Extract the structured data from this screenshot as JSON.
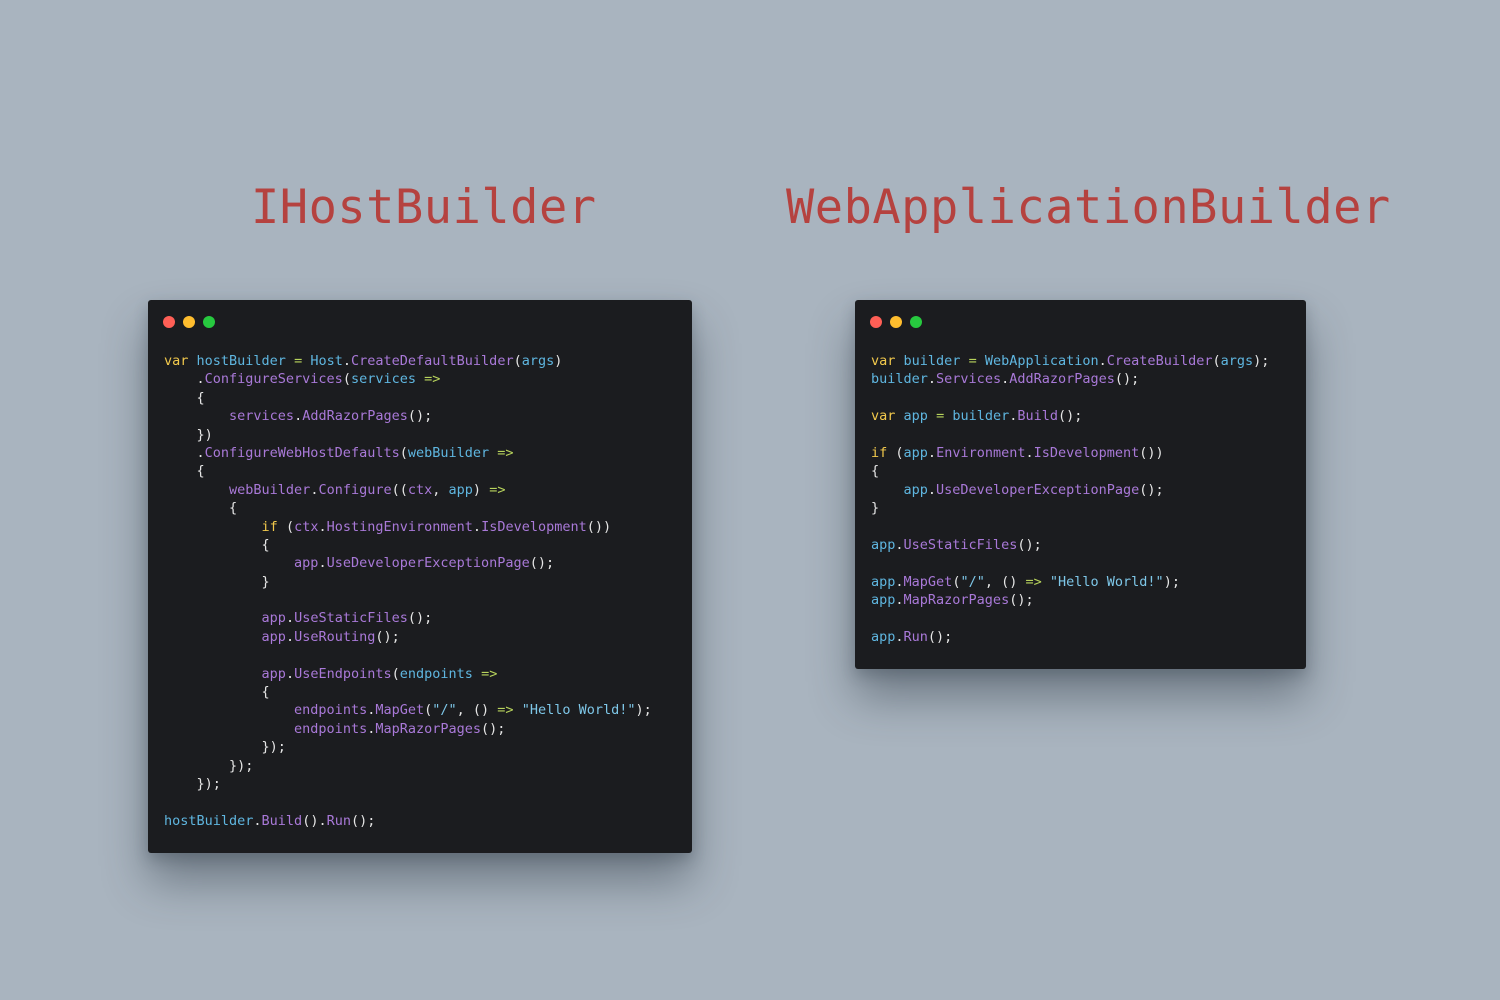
{
  "colors": {
    "background": "#a9b4bf",
    "title": "#b5423f",
    "window_bg": "#1b1c1f",
    "dot_red": "#ff5f56",
    "dot_yellow": "#ffbd2e",
    "dot_green": "#27c93f",
    "kw": "#f2c94c",
    "var": "#5fb6e0",
    "fn": "#a979d8",
    "punc": "#e6e6e6",
    "op": "#b8d45c",
    "str": "#7ec7e8"
  },
  "titles": {
    "left": "IHostBuilder",
    "right": "WebApplicationBuilder"
  },
  "panels": [
    {
      "window_controls": [
        "close-dot",
        "minimize-dot",
        "maximize-dot"
      ],
      "lines": [
        [
          [
            "kw",
            "var"
          ],
          [
            "p",
            " "
          ],
          [
            "var",
            "hostBuilder"
          ],
          [
            "p",
            " "
          ],
          [
            "op",
            "="
          ],
          [
            "p",
            " "
          ],
          [
            "var",
            "Host"
          ],
          [
            "p",
            "."
          ],
          [
            "fn",
            "CreateDefaultBuilder"
          ],
          [
            "p",
            "("
          ],
          [
            "var",
            "args"
          ],
          [
            "p",
            ")"
          ]
        ],
        [
          [
            "p",
            "    ."
          ],
          [
            "fn",
            "ConfigureServices"
          ],
          [
            "p",
            "("
          ],
          [
            "var",
            "services"
          ],
          [
            "p",
            " "
          ],
          [
            "op",
            "=>"
          ]
        ],
        [
          [
            "p",
            "    {"
          ]
        ],
        [
          [
            "p",
            "        "
          ],
          [
            "fn",
            "services"
          ],
          [
            "p",
            "."
          ],
          [
            "fn",
            "AddRazorPages"
          ],
          [
            "p",
            "();"
          ]
        ],
        [
          [
            "p",
            "    })"
          ]
        ],
        [
          [
            "p",
            "    ."
          ],
          [
            "fn",
            "ConfigureWebHostDefaults"
          ],
          [
            "p",
            "("
          ],
          [
            "var",
            "webBuilder"
          ],
          [
            "p",
            " "
          ],
          [
            "op",
            "=>"
          ]
        ],
        [
          [
            "p",
            "    {"
          ]
        ],
        [
          [
            "p",
            "        "
          ],
          [
            "fn",
            "webBuilder"
          ],
          [
            "p",
            "."
          ],
          [
            "fn",
            "Configure"
          ],
          [
            "p",
            "(("
          ],
          [
            "fn",
            "ctx"
          ],
          [
            "p",
            ", "
          ],
          [
            "var",
            "app"
          ],
          [
            "p",
            ") "
          ],
          [
            "op",
            "=>"
          ]
        ],
        [
          [
            "p",
            "        {"
          ]
        ],
        [
          [
            "p",
            "            "
          ],
          [
            "kw",
            "if"
          ],
          [
            "p",
            " ("
          ],
          [
            "fn",
            "ctx"
          ],
          [
            "p",
            "."
          ],
          [
            "fn",
            "HostingEnvironment"
          ],
          [
            "p",
            "."
          ],
          [
            "fn",
            "IsDevelopment"
          ],
          [
            "p",
            "())"
          ]
        ],
        [
          [
            "p",
            "            {"
          ]
        ],
        [
          [
            "p",
            "                "
          ],
          [
            "fn",
            "app"
          ],
          [
            "p",
            "."
          ],
          [
            "fn",
            "UseDeveloperExceptionPage"
          ],
          [
            "p",
            "();"
          ]
        ],
        [
          [
            "p",
            "            }"
          ]
        ],
        [
          [
            "p",
            ""
          ]
        ],
        [
          [
            "p",
            "            "
          ],
          [
            "fn",
            "app"
          ],
          [
            "p",
            "."
          ],
          [
            "fn",
            "UseStaticFiles"
          ],
          [
            "p",
            "();"
          ]
        ],
        [
          [
            "p",
            "            "
          ],
          [
            "fn",
            "app"
          ],
          [
            "p",
            "."
          ],
          [
            "fn",
            "UseRouting"
          ],
          [
            "p",
            "();"
          ]
        ],
        [
          [
            "p",
            ""
          ]
        ],
        [
          [
            "p",
            "            "
          ],
          [
            "fn",
            "app"
          ],
          [
            "p",
            "."
          ],
          [
            "fn",
            "UseEndpoints"
          ],
          [
            "p",
            "("
          ],
          [
            "var",
            "endpoints"
          ],
          [
            "p",
            " "
          ],
          [
            "op",
            "=>"
          ]
        ],
        [
          [
            "p",
            "            {"
          ]
        ],
        [
          [
            "p",
            "                "
          ],
          [
            "fn",
            "endpoints"
          ],
          [
            "p",
            "."
          ],
          [
            "fn",
            "MapGet"
          ],
          [
            "p",
            "("
          ],
          [
            "str",
            "\"/\""
          ],
          [
            "p",
            ", () "
          ],
          [
            "op",
            "=>"
          ],
          [
            "p",
            " "
          ],
          [
            "str",
            "\"Hello World!\""
          ],
          [
            "p",
            ");"
          ]
        ],
        [
          [
            "p",
            "                "
          ],
          [
            "fn",
            "endpoints"
          ],
          [
            "p",
            "."
          ],
          [
            "fn",
            "MapRazorPages"
          ],
          [
            "p",
            "();"
          ]
        ],
        [
          [
            "p",
            "            });"
          ]
        ],
        [
          [
            "p",
            "        });"
          ]
        ],
        [
          [
            "p",
            "    });"
          ]
        ],
        [
          [
            "p",
            ""
          ]
        ],
        [
          [
            "var",
            "hostBuilder"
          ],
          [
            "p",
            "."
          ],
          [
            "fn",
            "Build"
          ],
          [
            "p",
            "()."
          ],
          [
            "fn",
            "Run"
          ],
          [
            "p",
            "();"
          ]
        ]
      ]
    },
    {
      "window_controls": [
        "close-dot",
        "minimize-dot",
        "maximize-dot"
      ],
      "lines": [
        [
          [
            "kw",
            "var"
          ],
          [
            "p",
            " "
          ],
          [
            "var",
            "builder"
          ],
          [
            "p",
            " "
          ],
          [
            "op",
            "="
          ],
          [
            "p",
            " "
          ],
          [
            "var",
            "WebApplication"
          ],
          [
            "p",
            "."
          ],
          [
            "fn",
            "CreateBuilder"
          ],
          [
            "p",
            "("
          ],
          [
            "var",
            "args"
          ],
          [
            "p",
            ");"
          ]
        ],
        [
          [
            "var",
            "builder"
          ],
          [
            "p",
            "."
          ],
          [
            "fn",
            "Services"
          ],
          [
            "p",
            "."
          ],
          [
            "fn",
            "AddRazorPages"
          ],
          [
            "p",
            "();"
          ]
        ],
        [
          [
            "p",
            ""
          ]
        ],
        [
          [
            "kw",
            "var"
          ],
          [
            "p",
            " "
          ],
          [
            "var",
            "app"
          ],
          [
            "p",
            " "
          ],
          [
            "op",
            "="
          ],
          [
            "p",
            " "
          ],
          [
            "var",
            "builder"
          ],
          [
            "p",
            "."
          ],
          [
            "fn",
            "Build"
          ],
          [
            "p",
            "();"
          ]
        ],
        [
          [
            "p",
            ""
          ]
        ],
        [
          [
            "kw",
            "if"
          ],
          [
            "p",
            " ("
          ],
          [
            "var",
            "app"
          ],
          [
            "p",
            "."
          ],
          [
            "fn",
            "Environment"
          ],
          [
            "p",
            "."
          ],
          [
            "fn",
            "IsDevelopment"
          ],
          [
            "p",
            "())"
          ]
        ],
        [
          [
            "p",
            "{"
          ]
        ],
        [
          [
            "p",
            "    "
          ],
          [
            "var",
            "app"
          ],
          [
            "p",
            "."
          ],
          [
            "fn",
            "UseDeveloperExceptionPage"
          ],
          [
            "p",
            "();"
          ]
        ],
        [
          [
            "p",
            "}"
          ]
        ],
        [
          [
            "p",
            ""
          ]
        ],
        [
          [
            "var",
            "app"
          ],
          [
            "p",
            "."
          ],
          [
            "fn",
            "UseStaticFiles"
          ],
          [
            "p",
            "();"
          ]
        ],
        [
          [
            "p",
            ""
          ]
        ],
        [
          [
            "var",
            "app"
          ],
          [
            "p",
            "."
          ],
          [
            "fn",
            "MapGet"
          ],
          [
            "p",
            "("
          ],
          [
            "str",
            "\"/\""
          ],
          [
            "p",
            ", () "
          ],
          [
            "op",
            "=>"
          ],
          [
            "p",
            " "
          ],
          [
            "str",
            "\"Hello World!\""
          ],
          [
            "p",
            ");"
          ]
        ],
        [
          [
            "var",
            "app"
          ],
          [
            "p",
            "."
          ],
          [
            "fn",
            "MapRazorPages"
          ],
          [
            "p",
            "();"
          ]
        ],
        [
          [
            "p",
            ""
          ]
        ],
        [
          [
            "var",
            "app"
          ],
          [
            "p",
            "."
          ],
          [
            "fn",
            "Run"
          ],
          [
            "p",
            "();"
          ]
        ]
      ]
    }
  ]
}
